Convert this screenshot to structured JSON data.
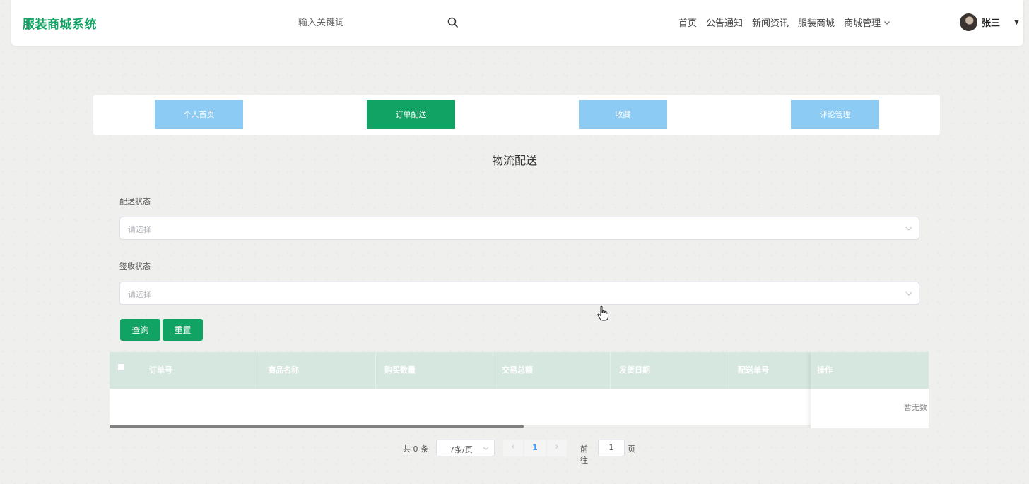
{
  "header": {
    "brand": "服装商城系统",
    "search_placeholder": "输入关键词",
    "nav": [
      "首页",
      "公告通知",
      "新闻资讯",
      "服装商城",
      "商城管理"
    ],
    "user_name": "张三"
  },
  "tabs": [
    {
      "label": "个人首页",
      "active": false
    },
    {
      "label": "订单配送",
      "active": true
    },
    {
      "label": "收藏",
      "active": false
    },
    {
      "label": "评论管理",
      "active": false
    }
  ],
  "page_title": "物流配送",
  "filters": {
    "delivery_status_label": "配送状态",
    "delivery_status_placeholder": "请选择",
    "sign_status_label": "签收状态",
    "sign_status_placeholder": "请选择",
    "query_button": "查询",
    "reset_button": "重置"
  },
  "table": {
    "columns": [
      "订单号",
      "商品名称",
      "购买数量",
      "交易总额",
      "发货日期",
      "配送单号",
      "操作"
    ],
    "empty_text": "暂无数"
  },
  "pagination": {
    "total_text": "共 0 条",
    "page_size": "7条/页",
    "current_page": "1",
    "goto_label": "前往",
    "goto_value": "1",
    "page_unit": "页"
  },
  "colors": {
    "accent": "#10a363",
    "tab_inactive": "#8ccbf3",
    "table_header": "#d5e7df",
    "pager_active": "#409eff"
  }
}
